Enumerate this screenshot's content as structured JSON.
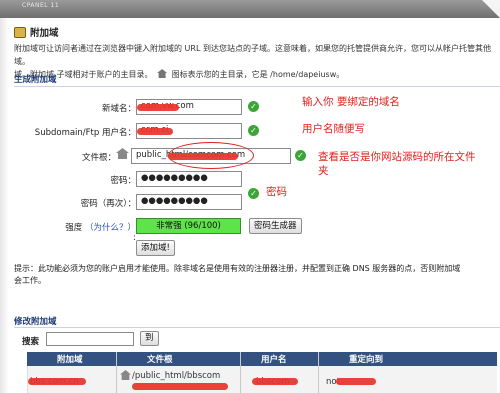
{
  "topbar": {
    "brand": "CPANEL 11"
  },
  "header": {
    "title": "附加域",
    "icon": "addon-domain-icon"
  },
  "description": {
    "line1": "附加域可让访问者通过在浏览器中键入附加域的 URL 到达您站点的子域。这意味着，如果您的托管提供商允许，您可以从帐户托管其他域。",
    "line2_a": "域。附加域 子域相对于账户的主目录。",
    "line2_b": "图标表示您的主目录，它是 /home/dapeiusw。"
  },
  "create_section": {
    "title": "生成附加域",
    "new_domain": {
      "label": "新域名：",
      "value": "com.vw.com"
    },
    "subdomain": {
      "label": "Subdomain/Ftp 用户名：",
      "value": "ccm.ci"
    },
    "docroot": {
      "label": "文件根：",
      "value": "public_html/comcom.com"
    },
    "password": {
      "label": "密码：",
      "value": "●●●●●●●●●"
    },
    "password_again": {
      "label": "密码（再次）：",
      "value": "●●●●●●●●●"
    },
    "strength": {
      "label": "强度",
      "help": "（为什么？）",
      "colon": ":",
      "value": "非常强 (96/100)"
    },
    "generator_button": "密码生成器",
    "add_button": "添加域",
    "add_button_suffix": "!"
  },
  "annotations": {
    "note1": "输入你 要绑定的域名",
    "note2": "用户名随便写",
    "note3_line1": "查看是否是你网站源码的所在文件",
    "note3_line2": "夹",
    "note4": "密码"
  },
  "tip": {
    "line1": "提示：此功能必须为您的账户启用才能使用。除非域名是使用有效的注册器注册，并配置到正确 DNS 服务器的点，否则附加域",
    "line2": "会工作。"
  },
  "modify_section": {
    "title": "修改附加域",
    "search_label": "搜索",
    "search_placeholder": "",
    "go_button": "到",
    "columns": [
      "附加域",
      "文件根",
      "用户名",
      "重定向到"
    ],
    "row": {
      "domain": "bbs.com.cn",
      "docroot": "/public_html/bbscom",
      "username": "bbscom",
      "redirect": "not"
    }
  },
  "colors": {
    "accent": "#34527f",
    "strength_green": "#5fe34a",
    "annotation_red": "#e0221d"
  }
}
